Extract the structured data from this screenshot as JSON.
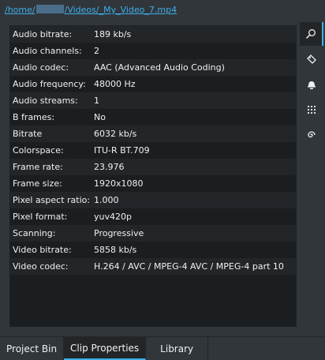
{
  "path": {
    "prefix": "/home/",
    "suffix": "/Videos/_My_Video_7.mp4"
  },
  "properties": [
    {
      "key": "Audio bitrate:",
      "value": "189 kb/s"
    },
    {
      "key": "Audio channels:",
      "value": "2"
    },
    {
      "key": "Audio codec:",
      "value": "AAC (Advanced Audio Coding)"
    },
    {
      "key": "Audio frequency:",
      "value": "48000 Hz"
    },
    {
      "key": "Audio streams:",
      "value": "1"
    },
    {
      "key": "B frames:",
      "value": "No"
    },
    {
      "key": "Bitrate",
      "value": "6032 kb/s"
    },
    {
      "key": "Colorspace:",
      "value": "ITU-R BT.709"
    },
    {
      "key": "Frame rate:",
      "value": "23.976"
    },
    {
      "key": "Frame size:",
      "value": "1920x1080"
    },
    {
      "key": "Pixel aspect ratio:",
      "value": "1.000"
    },
    {
      "key": "Pixel format:",
      "value": "yuv420p"
    },
    {
      "key": "Scanning:",
      "value": "Progressive"
    },
    {
      "key": "Video bitrate:",
      "value": "5858 kb/s"
    },
    {
      "key": "Video codec:",
      "value": "H.264 / AVC / MPEG-4 AVC / MPEG-4 part 10"
    }
  ],
  "rail": [
    {
      "icon": "search-icon",
      "active": true
    },
    {
      "icon": "tag-icon",
      "active": false
    },
    {
      "icon": "bell-icon",
      "active": false
    },
    {
      "icon": "dots-grid-icon",
      "active": false
    },
    {
      "icon": "spiral-icon",
      "active": false
    }
  ],
  "tabs": {
    "project_bin": "Project Bin",
    "clip_properties": "Clip Properties",
    "library": "Library"
  },
  "colors": {
    "accent": "#3daee9",
    "background": "#31363b",
    "table_bg": "#1b1e20",
    "row_alt": "#232629"
  }
}
